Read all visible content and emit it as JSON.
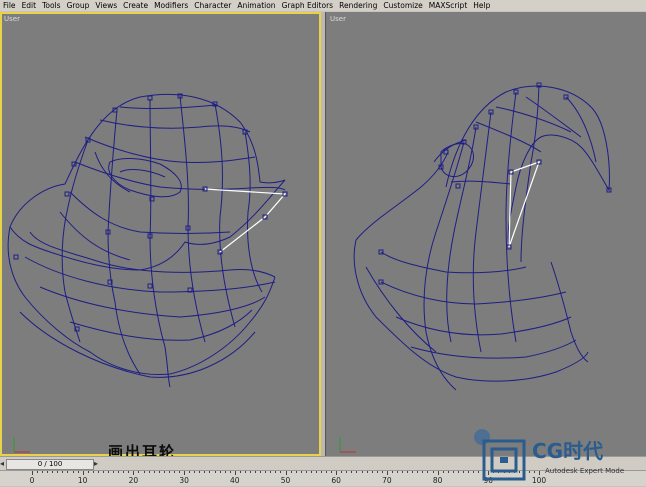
{
  "menu": [
    "File",
    "Edit",
    "Tools",
    "Group",
    "Views",
    "Create",
    "Modifiers",
    "Character",
    "Animation",
    "Graph Editors",
    "Rendering",
    "Customize",
    "MAXScript",
    "Help"
  ],
  "viewports": {
    "left": {
      "label": "User"
    },
    "right": {
      "label": "User"
    }
  },
  "caption": "画出耳轮",
  "timeline": {
    "frame": "0 / 100",
    "left_arrow": "◂",
    "right_arrow": "▸"
  },
  "ruler": {
    "ticks": [
      "0",
      "10",
      "20",
      "30",
      "40",
      "50",
      "60",
      "70",
      "80",
      "90",
      "100"
    ]
  },
  "watermark": {
    "brand": "CG时代",
    "sub": "Autodesk Expert Mode"
  },
  "colors": {
    "wire": "#1e1e84",
    "selected_edge": "#ffffff",
    "active_border": "#e6d34a",
    "viewport_bg": "#7d7d7d"
  }
}
